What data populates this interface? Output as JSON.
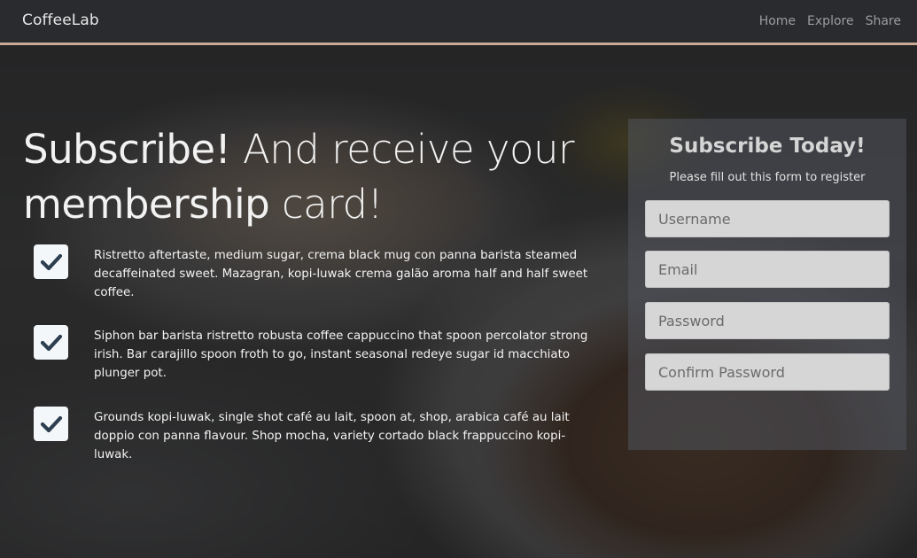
{
  "navbar": {
    "brand": "CoffeeLab",
    "links": [
      "Home",
      "Explore",
      "Share"
    ]
  },
  "hero": {
    "title_strong_1": "Subscribe!",
    "title_light_1": " And receive your ",
    "title_strong_2": "membership",
    "title_light_2": " card!"
  },
  "features": [
    {
      "icon": "checkmark-icon",
      "text": "Ristretto aftertaste, medium sugar, crema black mug con panna barista steamed decaffeinated sweet. Mazagran, kopi-luwak crema galão aroma half and half sweet coffee."
    },
    {
      "icon": "checkmark-icon",
      "text": "Siphon bar barista ristretto robusta coffee cappuccino that spoon percolator strong irish. Bar carajillo spoon froth to go, instant seasonal redeye sugar id macchiato plunger pot."
    },
    {
      "icon": "checkmark-icon",
      "text": "Grounds kopi-luwak, single shot café au lait, spoon at, shop, arabica café au lait doppio con panna flavour. Shop mocha, variety cortado black frappuccino kopi-luwak."
    }
  ],
  "form": {
    "title": "Subscribe Today!",
    "subtitle": "Please fill out this form to register",
    "fields": [
      {
        "placeholder": "Username",
        "value": ""
      },
      {
        "placeholder": "Email",
        "value": ""
      },
      {
        "placeholder": "Password",
        "value": ""
      },
      {
        "placeholder": "Confirm Password",
        "value": ""
      }
    ]
  },
  "colors": {
    "navbar_bg": "#292b2f",
    "navbar_border": "#c9a996",
    "check_icon": "#2c3e50",
    "panel_bg": "rgba(80,84,92,0.55)"
  }
}
